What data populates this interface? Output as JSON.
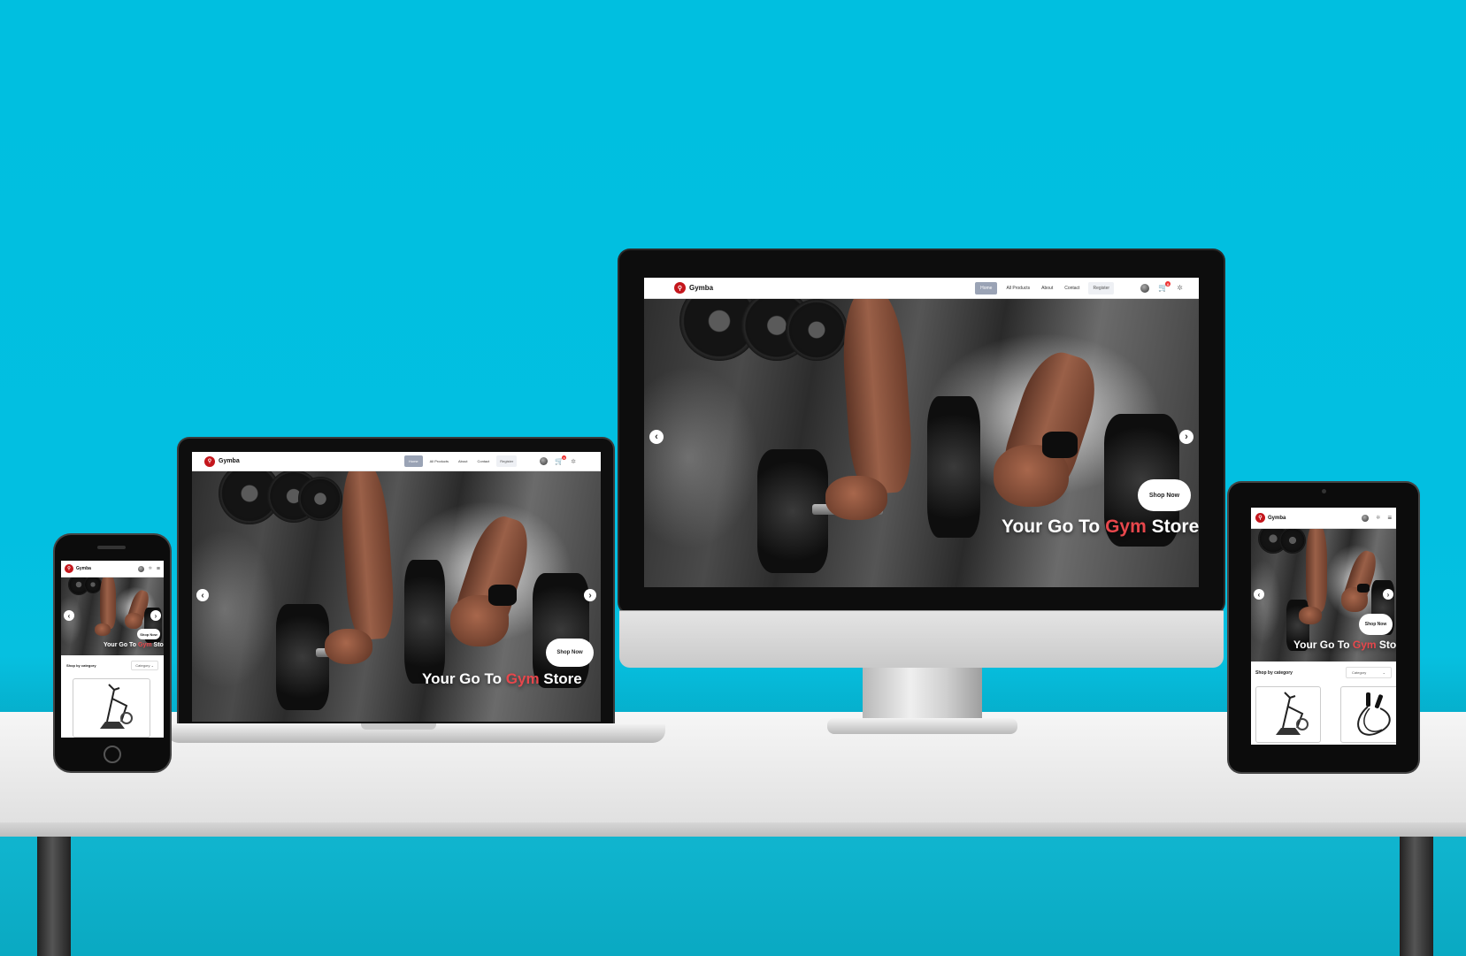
{
  "site": {
    "brand": "Gymba",
    "logo_icon": "dumbbell-logo-icon",
    "nav": {
      "items": [
        {
          "label": "Home",
          "active": true
        },
        {
          "label": "All Products",
          "active": false
        },
        {
          "label": "About",
          "active": false
        },
        {
          "label": "Contact",
          "active": false
        },
        {
          "label": "Register",
          "active": false
        }
      ],
      "cart_count": "0",
      "icons": [
        "user-avatar",
        "cart-icon",
        "settings-icon"
      ]
    },
    "hero": {
      "tagline_before": "Your Go To",
      "tagline_highlight": "Gym",
      "tagline_after": "Store",
      "cta": "Shop Now",
      "prev_arrow": "‹",
      "next_arrow": "›"
    },
    "category": {
      "label": "Shop by category",
      "select_value": "Category"
    }
  },
  "colors": {
    "background": "#00bfe0",
    "brand_red": "#c4161c",
    "highlight": "#e7474c",
    "nav_active": "#9aa3b5"
  }
}
